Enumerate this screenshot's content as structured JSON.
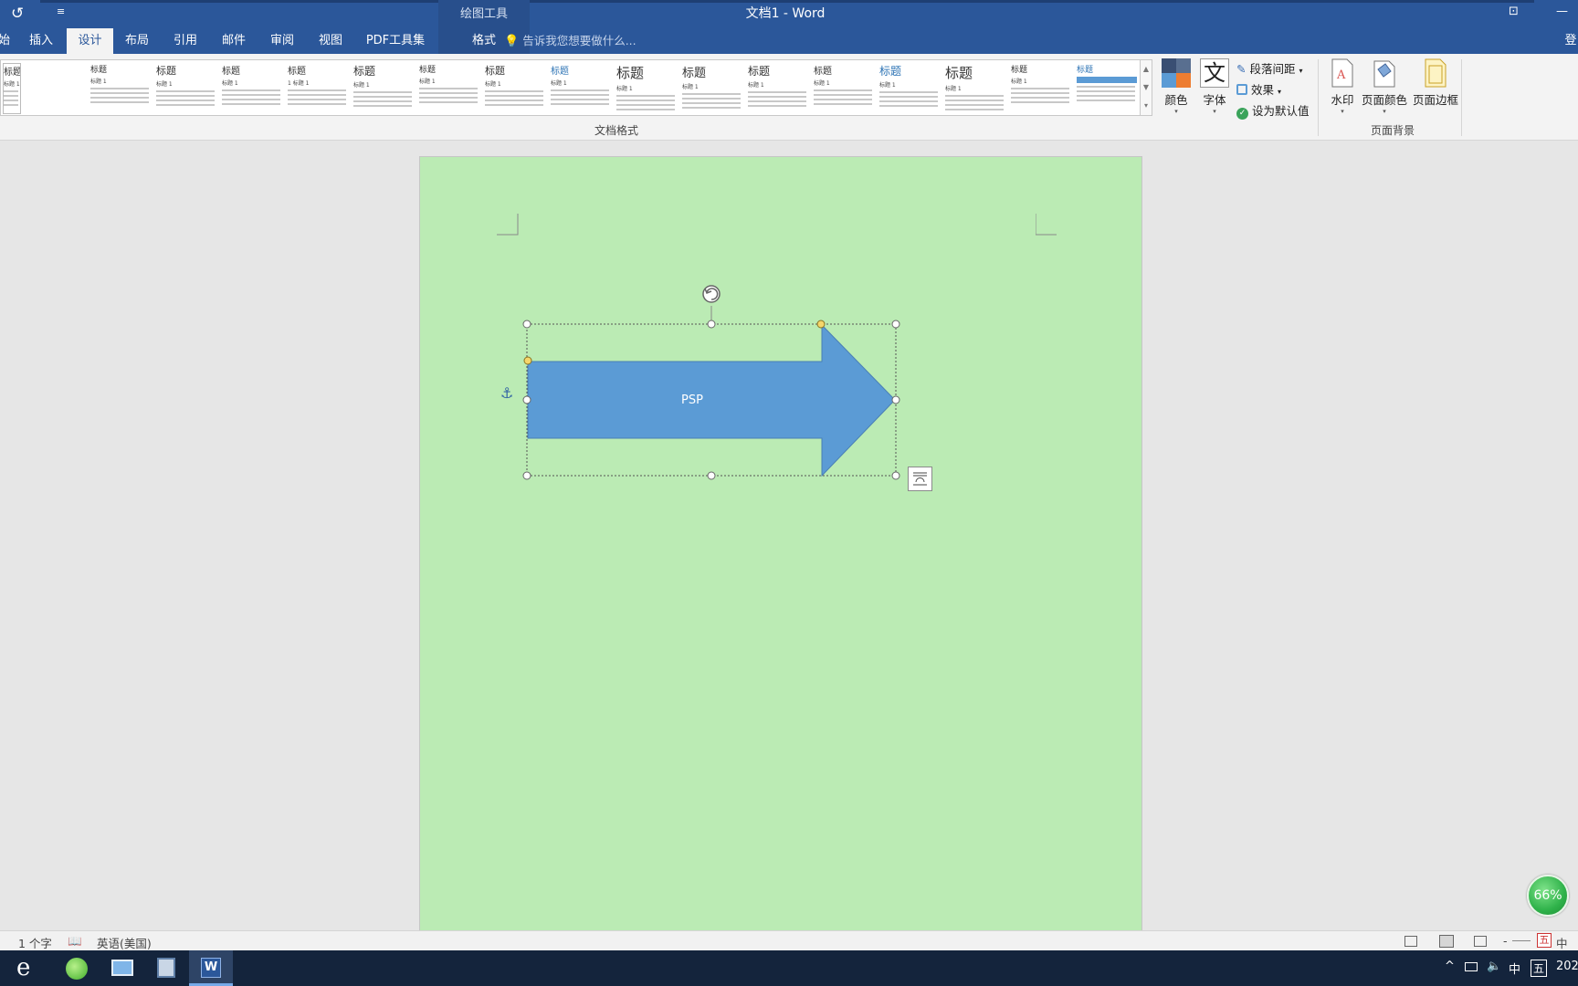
{
  "titlebar": {
    "undo_icon": "undo-icon",
    "qat_more": "≡",
    "context_title": "绘图工具",
    "doc_title": "文档1 - Word",
    "restore_icon": "ribbon-display-icon",
    "restore_glyph": "⊡",
    "minimize_glyph": "—"
  },
  "tabs": [
    {
      "label": "始"
    },
    {
      "label": "插入"
    },
    {
      "label": "设计"
    },
    {
      "label": "布局"
    },
    {
      "label": "引用"
    },
    {
      "label": "邮件"
    },
    {
      "label": "审阅"
    },
    {
      "label": "视图"
    },
    {
      "label": "PDF工具集"
    },
    {
      "label": "格式"
    }
  ],
  "active_tab": "设计",
  "tellme": {
    "placeholder": "告诉我您想要做什么...",
    "icon": "lightbulb-icon"
  },
  "account_label": "登",
  "ribbon": {
    "gallery": {
      "items": [
        {
          "title": "标题",
          "sub": "标题 1"
        },
        {
          "title": "标题",
          "sub": "标题 1"
        },
        {
          "title": "标题",
          "sub": "标题 1"
        },
        {
          "title": "标题",
          "sub": "标题 1"
        },
        {
          "title": "标题",
          "sub": "1 标题 1"
        },
        {
          "title": "标题",
          "sub": "标题 1"
        },
        {
          "title": "标题",
          "sub": "标题 1"
        },
        {
          "title": "标题",
          "sub": "标题 1"
        },
        {
          "title": "标题",
          "sub": "标题 1"
        },
        {
          "title": "标题",
          "sub": "标题 1"
        },
        {
          "title": "标题",
          "sub": "标题 1"
        },
        {
          "title": "标题",
          "sub": "标题 1"
        },
        {
          "title": "标题",
          "sub": "标题 1"
        },
        {
          "title": "标题",
          "sub": "标题 1"
        },
        {
          "title": "标题",
          "sub": "标题 1"
        },
        {
          "title": "标题",
          "sub": "标题 1"
        },
        {
          "title": "标题",
          "sub": "标题 1"
        }
      ],
      "scroll_up": "▲",
      "scroll_down": "▼",
      "more": "▾"
    },
    "colors_label": "颜色",
    "fonts_label": "字体",
    "fonts_glyph": "文",
    "para_spacing_label": "段落间距",
    "effects_label": "效果",
    "set_default_label": "设为默认值",
    "doc_format_group_label": "文档格式",
    "watermark_label": "水印",
    "page_color_label": "页面颜色",
    "page_border_label": "页面边框",
    "page_bg_group_label": "页面背景",
    "colors": {
      "navy": "#3a4f73",
      "slate": "#596f90",
      "blue": "#5b9bd5",
      "orange": "#ed7d31"
    }
  },
  "document": {
    "page_color": "#bbebb4",
    "shape_fill": "#5b9bd5",
    "shape_text": "PSP",
    "para_mark": "↵",
    "anchor_glyph": "⚓"
  },
  "zoom_badge": "66%",
  "statusbar": {
    "word_count": "1 个字",
    "proofing_icon": "proofing-icon",
    "language": "英语(美国)",
    "zoom_minus": "-",
    "ime_glyph": "五",
    "ime_lang": "中"
  },
  "taskbar": {
    "apps": [
      {
        "name": "ie-icon"
      },
      {
        "name": "browser-icon"
      },
      {
        "name": "control-panel-icon"
      },
      {
        "name": "network-icon"
      },
      {
        "name": "word-icon"
      }
    ],
    "tray_up": "^",
    "tray_ime": "中",
    "tray_ime2": "五",
    "clock": "202"
  }
}
